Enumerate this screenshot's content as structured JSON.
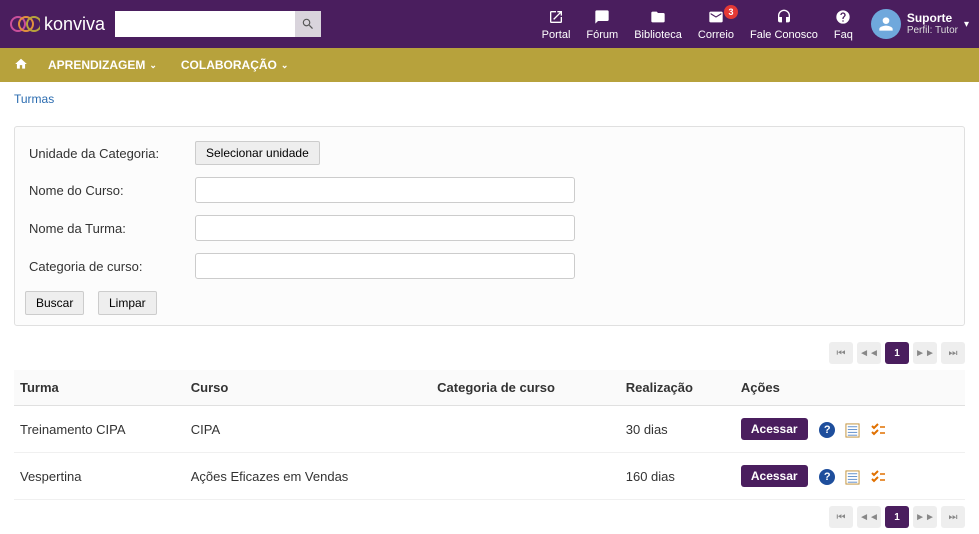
{
  "app": {
    "name": "konviva"
  },
  "topnav": {
    "portal": "Portal",
    "forum": "Fórum",
    "biblioteca": "Biblioteca",
    "correio": "Correio",
    "correio_badge": "3",
    "fale": "Fale Conosco",
    "faq": "Faq"
  },
  "user": {
    "name": "Suporte",
    "role": "Perfil: Tutor"
  },
  "nav": {
    "learn": "APRENDIZAGEM",
    "collab": "COLABORAÇÃO"
  },
  "breadcrumb": "Turmas",
  "filter": {
    "unit_label": "Unidade da Categoria:",
    "unit_btn": "Selecionar unidade",
    "course_label": "Nome do Curso:",
    "course_value": "",
    "class_label": "Nome da Turma:",
    "class_value": "",
    "category_label": "Categoria de curso:",
    "category_value": "",
    "search_btn": "Buscar",
    "clear_btn": "Limpar"
  },
  "table": {
    "headers": {
      "turma": "Turma",
      "curso": "Curso",
      "categoria": "Categoria de curso",
      "realizacao": "Realização",
      "acoes": "Ações"
    },
    "rows": [
      {
        "turma": "Treinamento CIPA",
        "curso": "CIPA",
        "categoria": "",
        "realizacao": "30 dias",
        "access": "Acessar"
      },
      {
        "turma": "Vespertina",
        "curso": "Ações Eficazes em Vendas",
        "categoria": "",
        "realizacao": "160 dias",
        "access": "Acessar"
      }
    ]
  },
  "pagination": {
    "current": "1"
  }
}
